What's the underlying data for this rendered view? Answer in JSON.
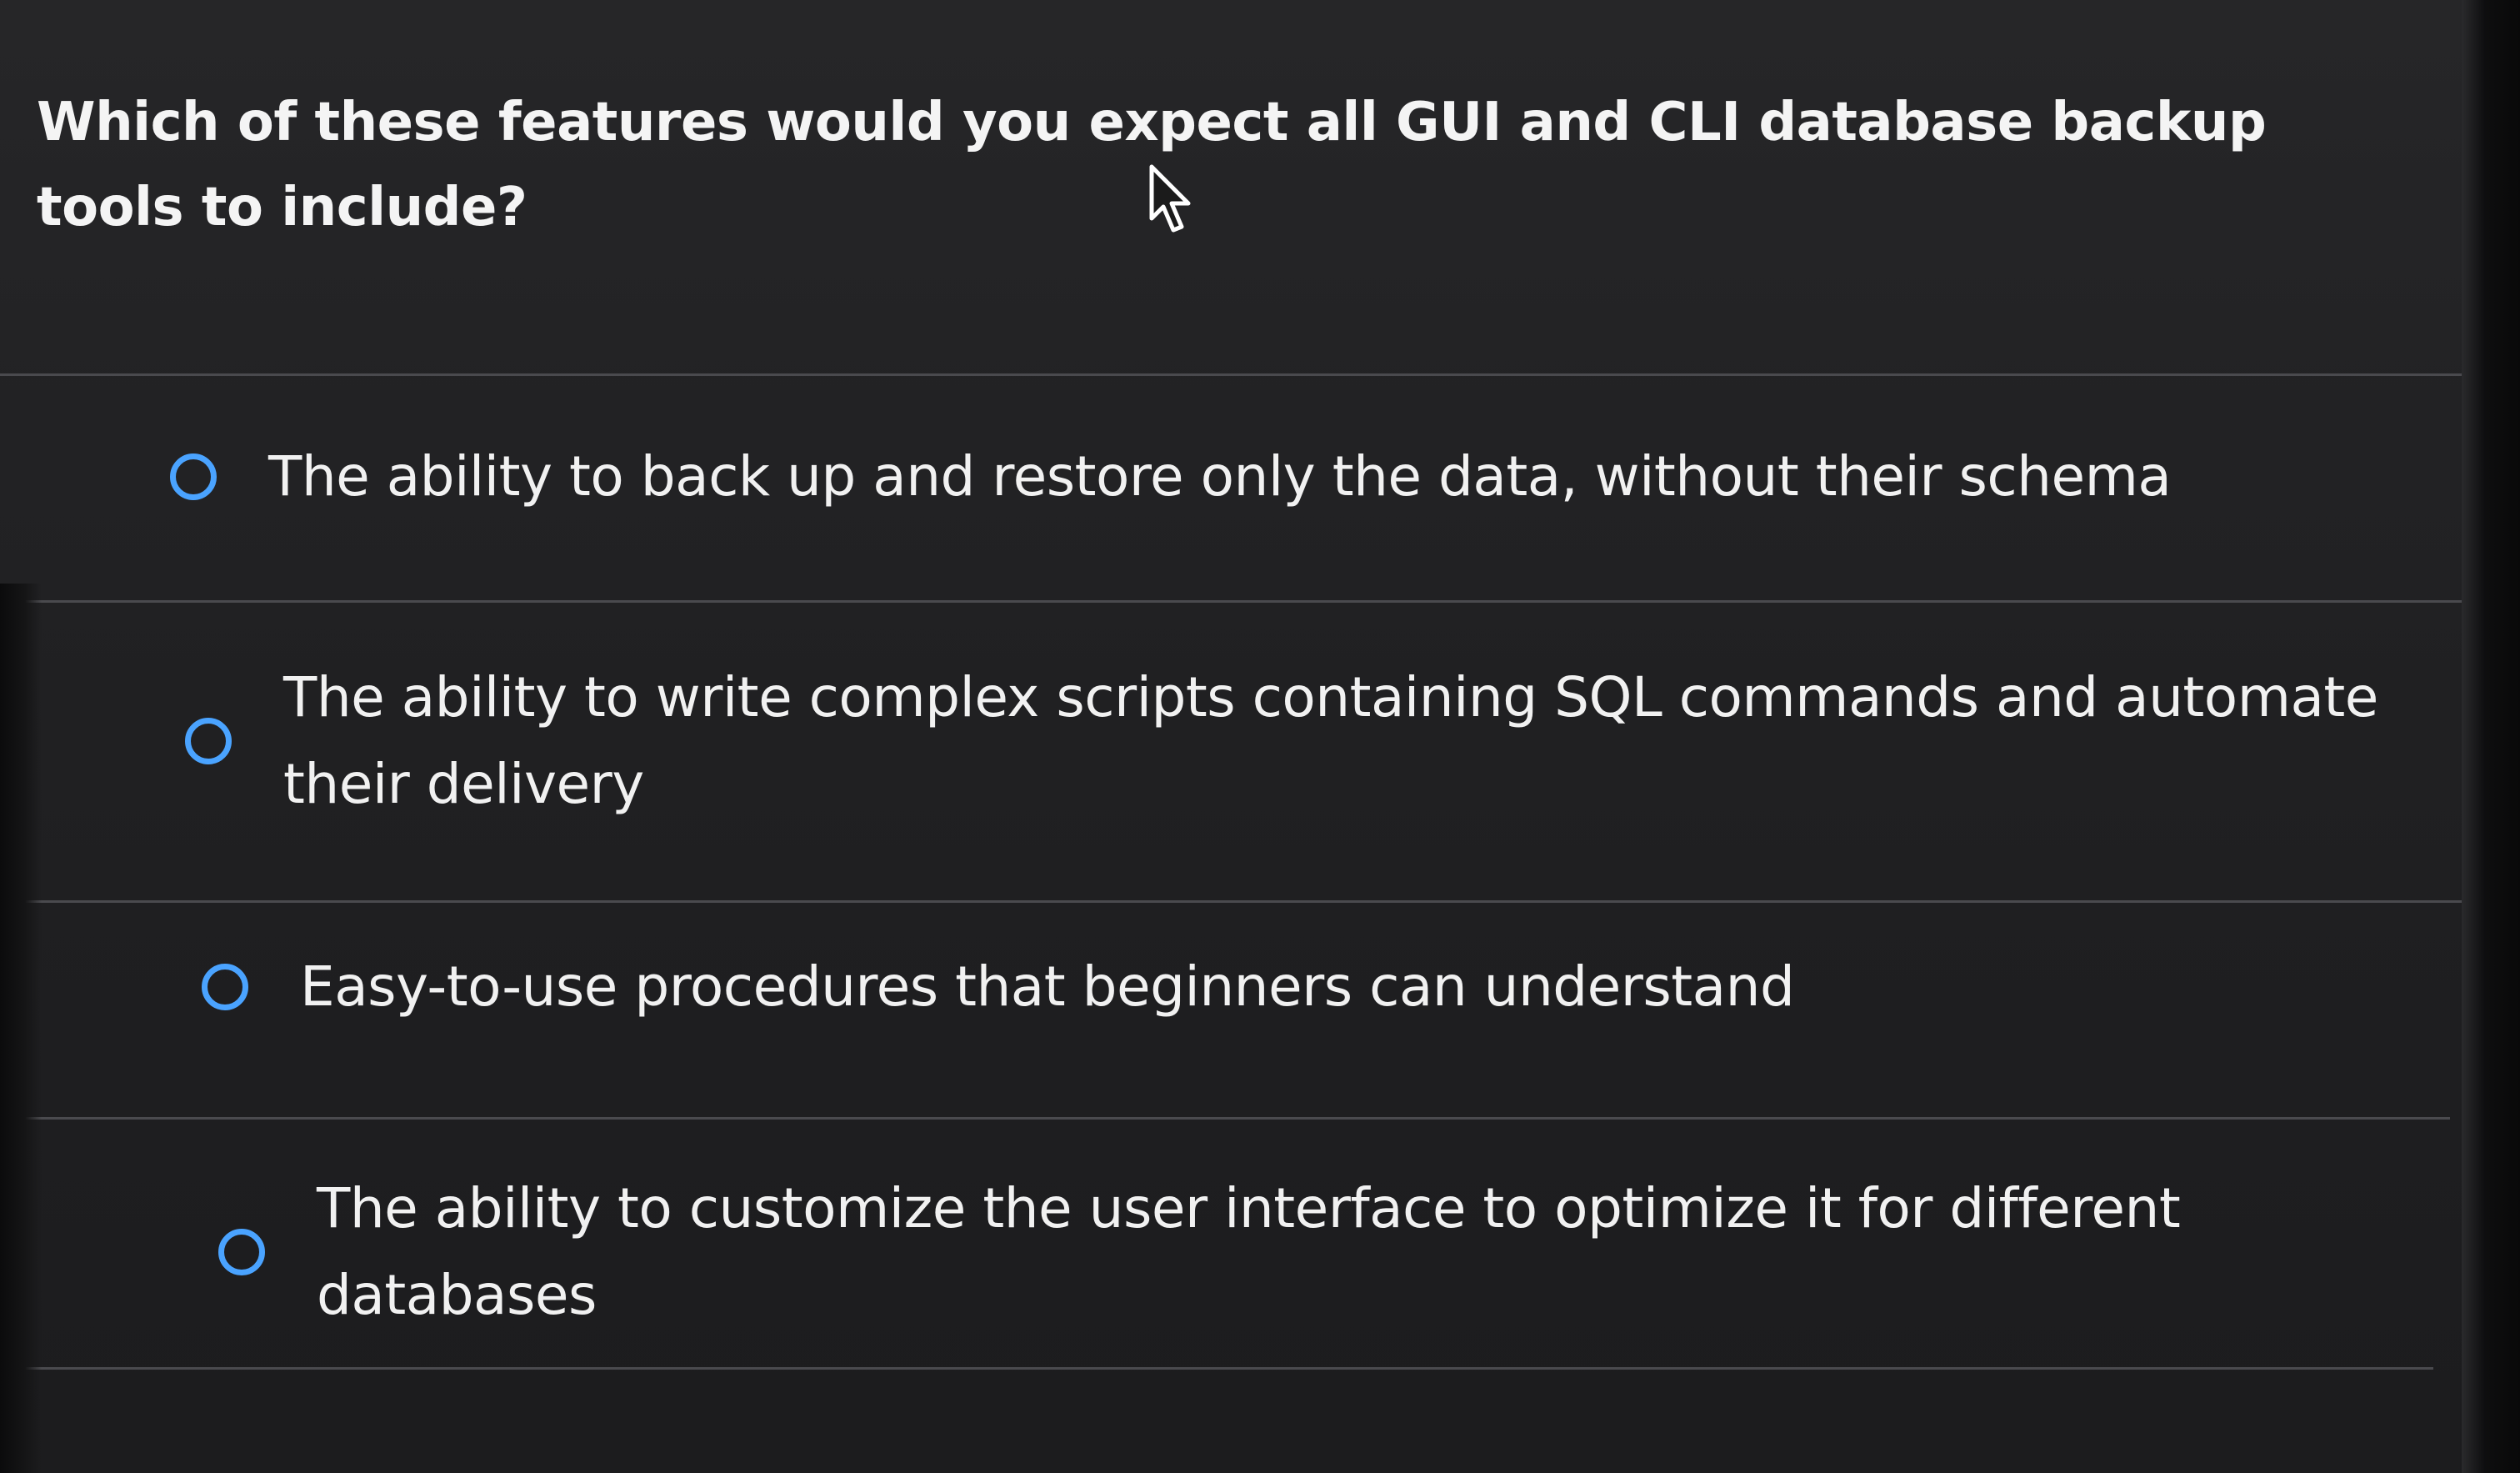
{
  "question": {
    "text": "Which of these features would you expect all GUI and CLI database backup tools to include?"
  },
  "options": [
    {
      "label": "The ability to back up and restore only the data, without their schema",
      "selected": false
    },
    {
      "label": "The ability to write complex scripts containing SQL commands and automate their delivery",
      "selected": false
    },
    {
      "label": "Easy-to-use procedures that beginners can understand",
      "selected": false
    },
    {
      "label": "The ability to customize the user interface to optimize it for different databases",
      "selected": false
    }
  ],
  "colors": {
    "background": "#1e1e20",
    "text": "#f1f1f1",
    "radio_border": "#4aa3ff",
    "divider": "#4a4a4e"
  },
  "icons": {
    "cursor": "mouse-pointer-icon",
    "radio": "radio-unselected-icon"
  }
}
